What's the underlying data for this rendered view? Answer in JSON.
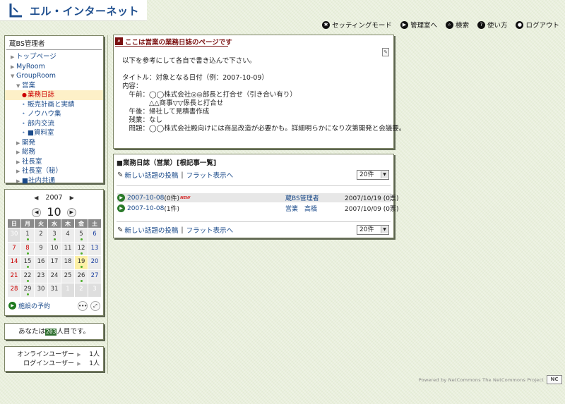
{
  "header": {
    "site_title": "エル・インターネット",
    "nav": [
      {
        "label": "セッティングモード",
        "icon": "gear-icon"
      },
      {
        "label": "管理室へ",
        "icon": "arrow-right-icon"
      },
      {
        "label": "検索",
        "icon": "search-icon"
      },
      {
        "label": "使い方",
        "icon": "help-icon"
      },
      {
        "label": "ログアウト",
        "icon": "user-icon"
      }
    ]
  },
  "menu": {
    "title": "蔵BS管理者",
    "items": [
      {
        "label": "トップページ"
      },
      {
        "label": "MyRoom"
      },
      {
        "label": "GroupRoom"
      },
      {
        "label": "営業"
      },
      {
        "label": "業務日誌"
      },
      {
        "label": "販売計画と実績"
      },
      {
        "label": "ノウハウ集"
      },
      {
        "label": "部内交流"
      },
      {
        "label": "■資料室"
      },
      {
        "label": "開発"
      },
      {
        "label": "総務"
      },
      {
        "label": "社長室"
      },
      {
        "label": "社長室（秘）"
      },
      {
        "label": "■社内共通"
      }
    ]
  },
  "calendar": {
    "year": "2007",
    "month": "10",
    "weekdays": [
      "日",
      "月",
      "火",
      "水",
      "木",
      "金",
      "土"
    ],
    "weeks": [
      [
        "30",
        "1",
        "2",
        "3",
        "4",
        "5",
        "6"
      ],
      [
        "7",
        "8",
        "9",
        "10",
        "11",
        "12",
        "13"
      ],
      [
        "14",
        "15",
        "16",
        "17",
        "18",
        "19",
        "20"
      ],
      [
        "21",
        "22",
        "23",
        "24",
        "25",
        "26",
        "27"
      ],
      [
        "28",
        "29",
        "30",
        "31",
        "1",
        "2",
        "3"
      ]
    ],
    "facility_link": "施設の予約"
  },
  "counter": {
    "prefix": "あなたは",
    "digits": "203",
    "suffix": "人目です。"
  },
  "online": {
    "rows": [
      {
        "label": "オンラインユーザー",
        "value": "1人"
      },
      {
        "label": "ログインユーザー",
        "value": "1人"
      }
    ]
  },
  "notice": {
    "title": "ここは営業の業務日誌のページです",
    "lines": [
      "以下を参考にして各自で書き込んで下さい。",
      "",
      "タイトル：対象となる日付（例：2007-10-09）",
      "内容：",
      "　午前：◯◯株式会社◎◎部長と打合せ（引き合い有り）",
      "　　　　△△商事▽▽係長と打合せ",
      "　午後：帰社して見積書作成",
      "　残業：なし",
      "　問題：◯◯株式会社殿向けには商品改造が必要かも。詳細明らかになり次第開発と会議要。"
    ]
  },
  "bbs": {
    "title": "■業務日誌（営業）[根記事一覧]",
    "new_post": "新しい話題の投稿",
    "flat_view": "フラット表示へ",
    "per_page": "20件",
    "new_badge": "NEW",
    "rows": [
      {
        "title": "2007-10-08",
        "count": "(0件)",
        "new": true,
        "author": "蔵BS管理者",
        "date": "2007/10/19 (0票)"
      },
      {
        "title": "2007-10-08",
        "count": "(1件)",
        "new": false,
        "author": "営業　高橋",
        "date": "2007/10/09 (0票)"
      }
    ]
  },
  "footer": {
    "powered": "Powered by NetCommons  The NetCommons Project",
    "logo": "NC"
  }
}
